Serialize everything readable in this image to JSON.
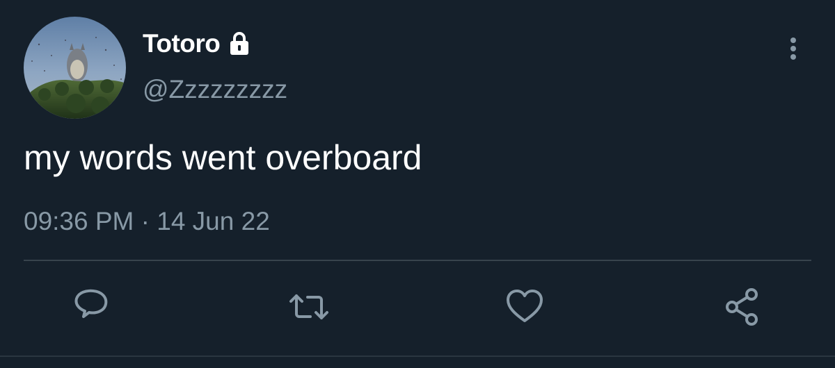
{
  "tweet": {
    "author": {
      "display_name": "Totoro",
      "handle": "@Zzzzzzzzz",
      "protected_icon": "lock-icon",
      "avatar": "totoro-avatar"
    },
    "text": "my words went overboard",
    "timestamp": "09:36 PM · 14 Jun 22",
    "menu_icon": "more-vertical-icon"
  },
  "actions": [
    {
      "name": "reply",
      "icon": "reply-icon"
    },
    {
      "name": "retweet",
      "icon": "retweet-icon"
    },
    {
      "name": "like",
      "icon": "heart-icon"
    },
    {
      "name": "share",
      "icon": "share-icon"
    }
  ],
  "colors": {
    "background": "#15202b",
    "text_primary": "#ffffff",
    "text_secondary": "#8899a6",
    "divider": "#38444d"
  }
}
